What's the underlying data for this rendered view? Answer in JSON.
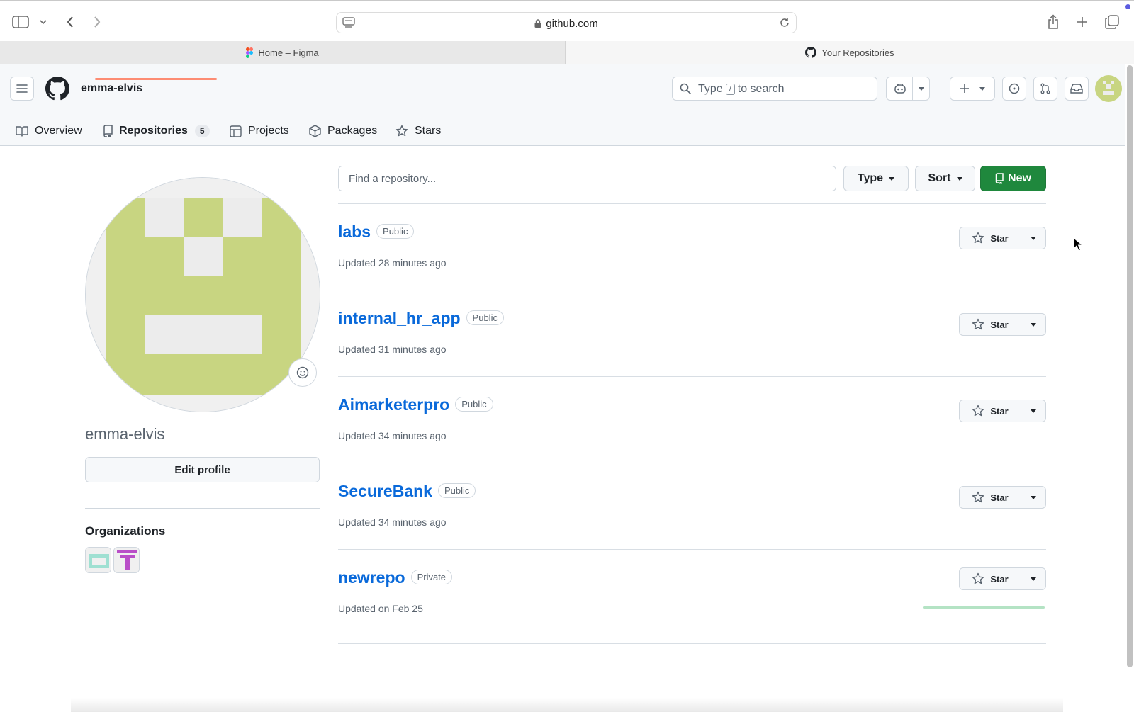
{
  "browser": {
    "url": "github.com",
    "tabs": [
      {
        "label": "Home – Figma"
      },
      {
        "label": "Your Repositories"
      }
    ]
  },
  "header": {
    "owner": "emma-elvis",
    "search": {
      "prefix": "Type",
      "key": "/",
      "suffix": "to search"
    }
  },
  "nav": {
    "items": [
      {
        "label": "Overview"
      },
      {
        "label": "Repositories",
        "count": "5"
      },
      {
        "label": "Projects"
      },
      {
        "label": "Packages"
      },
      {
        "label": "Stars"
      }
    ]
  },
  "profile": {
    "username": "emma-elvis",
    "edit_label": "Edit profile",
    "organizations_heading": "Organizations"
  },
  "toolbar": {
    "find_placeholder": "Find a repository...",
    "type_label": "Type",
    "sort_label": "Sort",
    "new_label": "New"
  },
  "repos": [
    {
      "name": "labs",
      "visibility": "Public",
      "updated": "Updated 28 minutes ago",
      "star_label": "Star"
    },
    {
      "name": "internal_hr_app",
      "visibility": "Public",
      "updated": "Updated 31 minutes ago",
      "star_label": "Star"
    },
    {
      "name": "Aimarketerpro",
      "visibility": "Public",
      "updated": "Updated 34 minutes ago",
      "star_label": "Star"
    },
    {
      "name": "SecureBank",
      "visibility": "Public",
      "updated": "Updated 34 minutes ago",
      "star_label": "Star"
    },
    {
      "name": "newrepo",
      "visibility": "Private",
      "updated": "Updated on Feb 25",
      "star_label": "Star"
    }
  ],
  "colors": {
    "accent_link": "#0969da",
    "new_button": "#1f883d",
    "nav_underline": "#fd8c73",
    "avatar_green": "#c8d581"
  }
}
